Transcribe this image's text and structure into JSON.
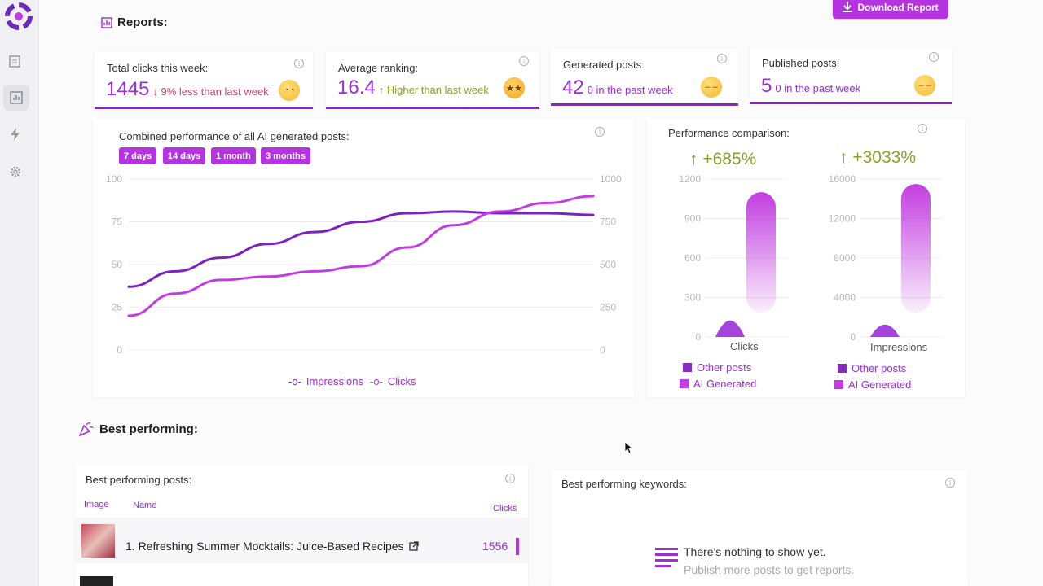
{
  "header": {
    "reports_title": "Reports:",
    "download_label": "Download Report"
  },
  "stats": [
    {
      "label": "Total clicks this week:",
      "value": "1445",
      "sub": "↓ 9% less than last week",
      "sub_color": "#c2456b"
    },
    {
      "label": "Average ranking:",
      "value": "16.4",
      "sub": "↑ Higher than last week",
      "sub_color": "#8aa02a"
    },
    {
      "label": "Generated posts:",
      "value": "42",
      "sub": "0 in the past week",
      "sub_color": "#9b30d8"
    },
    {
      "label": "Published posts:",
      "value": "5",
      "sub": "0 in the past week",
      "sub_color": "#9b30d8"
    }
  ],
  "combined": {
    "title": "Combined performance of all AI generated posts:",
    "ranges": [
      "7 days",
      "14 days",
      "1 month",
      "3 months"
    ],
    "legend": [
      "Impressions",
      "Clicks"
    ]
  },
  "comparison": {
    "title": "Performance comparison:",
    "clicks_change": "↑ +685%",
    "impressions_change": "↑ +3033%",
    "clicks_label": "Clicks",
    "impressions_label": "Impressions",
    "legend_other": "Other posts",
    "legend_ai": "AI Generated"
  },
  "chart_data": [
    {
      "type": "line",
      "x": [
        0,
        1,
        2,
        3,
        4,
        5,
        6,
        7,
        8,
        9,
        10
      ],
      "series": [
        {
          "name": "Impressions",
          "axis": "left",
          "values": [
            37,
            46,
            54,
            62,
            69,
            75,
            80,
            81,
            80,
            80,
            79
          ],
          "color": "#7c22c0"
        },
        {
          "name": "Clicks",
          "axis": "right",
          "values": [
            200,
            330,
            410,
            430,
            460,
            490,
            600,
            730,
            810,
            860,
            900
          ],
          "color": "#c23de0"
        }
      ],
      "ylim_left": [
        0,
        100
      ],
      "ylim_right": [
        0,
        1000
      ],
      "yticks_left": [
        "0",
        "25",
        "50",
        "75",
        "100"
      ],
      "yticks_right": [
        "0",
        "250",
        "500",
        "750",
        "1000"
      ]
    },
    {
      "type": "bar",
      "categories": [
        "Clicks"
      ],
      "series": [
        {
          "name": "Other posts",
          "values": [
            150
          ]
        },
        {
          "name": "AI Generated",
          "values": [
            1100
          ]
        }
      ],
      "ylim": [
        0,
        1200
      ],
      "yticks": [
        "0",
        "300",
        "600",
        "900",
        "1200"
      ]
    },
    {
      "type": "bar",
      "categories": [
        "Impressions"
      ],
      "series": [
        {
          "name": "Other posts",
          "values": [
            1200
          ]
        },
        {
          "name": "AI Generated",
          "values": [
            15500
          ]
        }
      ],
      "ylim": [
        0,
        16000
      ],
      "yticks": [
        "0",
        "4000",
        "8000",
        "12000",
        "16000"
      ]
    }
  ],
  "best": {
    "title": "Best performing:",
    "posts_title": "Best performing posts:",
    "col_image": "Image",
    "col_name": "Name",
    "col_clicks": "Clicks",
    "rows": [
      {
        "name": "1. Refreshing Summer Mocktails: Juice-Based Recipes",
        "clicks": "1556"
      }
    ],
    "keywords_title": "Best performing keywords:",
    "empty_title": "There's nothing to show yet.",
    "empty_sub": "Publish more posts to get reports."
  }
}
